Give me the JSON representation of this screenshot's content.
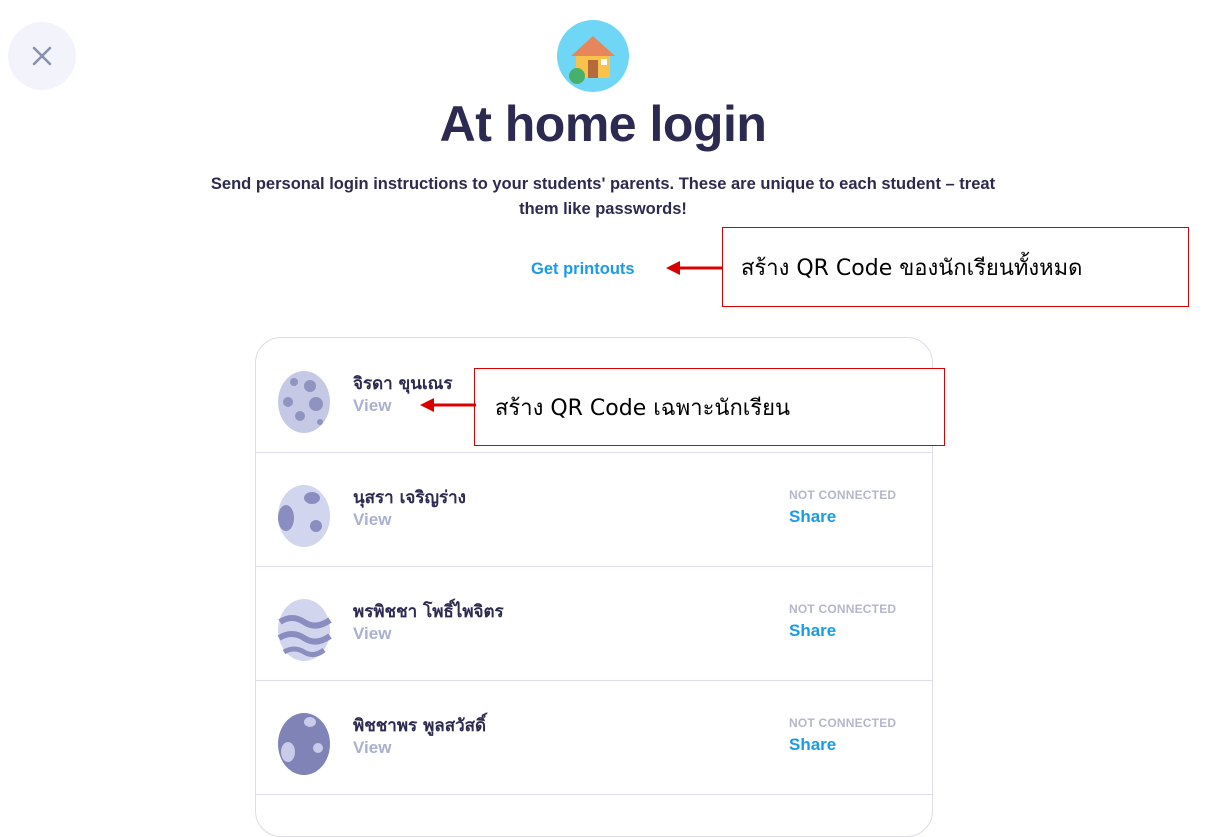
{
  "header": {
    "title": "At home login",
    "subtitle": "Send personal login instructions to your students' parents. These are unique to each student – treat them like passwords!",
    "printouts_link": "Get printouts",
    "close_icon": "close-icon",
    "house_icon": "house-icon"
  },
  "annotations": {
    "printouts_note": "สร้าง QR Code ของนักเรียนทั้งหมด",
    "student_note": "สร้าง QR Code เฉพาะนักเรียน",
    "color": "#d90000"
  },
  "students": [
    {
      "name": "จิรดา ขุนเณร",
      "view": "View",
      "status": "",
      "share": "",
      "avatar": "egg-dots-icon"
    },
    {
      "name": "นุสรา เจริญร่าง",
      "view": "View",
      "status": "NOT CONNECTED",
      "share": "Share",
      "avatar": "egg-spots-icon"
    },
    {
      "name": "พรพิชชา โพธิ์ไพจิตร",
      "view": "View",
      "status": "NOT CONNECTED",
      "share": "Share",
      "avatar": "egg-waves-icon"
    },
    {
      "name": "พิชชาพร พูลสวัสดิ์",
      "view": "View",
      "status": "NOT CONNECTED",
      "share": "Share",
      "avatar": "egg-large-spots-icon"
    }
  ],
  "colors": {
    "accent": "#1a9be8",
    "title": "#2c2a50",
    "muted": "#aab0cf"
  }
}
